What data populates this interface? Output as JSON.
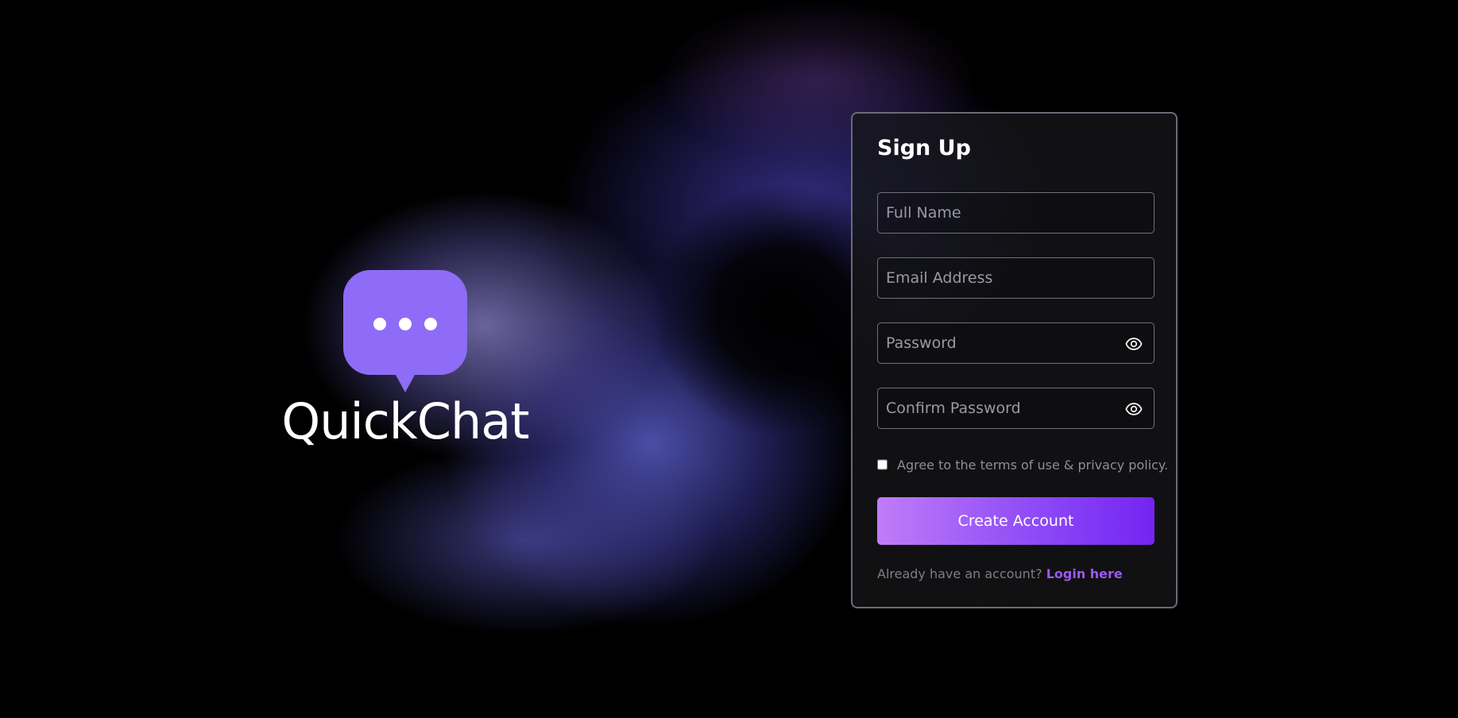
{
  "brand": {
    "name": "QuickChat",
    "logo_icon": "chat-bubble-dots-icon",
    "logo_color": "#8e6cf7"
  },
  "signup": {
    "title": "Sign Up",
    "full_name": {
      "placeholder": "Full Name",
      "value": ""
    },
    "email": {
      "placeholder": "Email Address",
      "value": ""
    },
    "password": {
      "placeholder": "Password",
      "value": "",
      "toggle_icon": "eye-icon"
    },
    "confirm_password": {
      "placeholder": "Confirm Password",
      "value": "",
      "toggle_icon": "eye-icon"
    },
    "terms": {
      "label": "Agree to the terms of use & privacy policy.",
      "checked": false
    },
    "submit_label": "Create Account",
    "login_prompt": "Already have an account?",
    "login_link": "Login here"
  },
  "colors": {
    "background": "#000000",
    "card_border": "#6a6a78",
    "accent_start": "#c07cf8",
    "accent_end": "#7424f2",
    "link": "#9b59f0"
  }
}
